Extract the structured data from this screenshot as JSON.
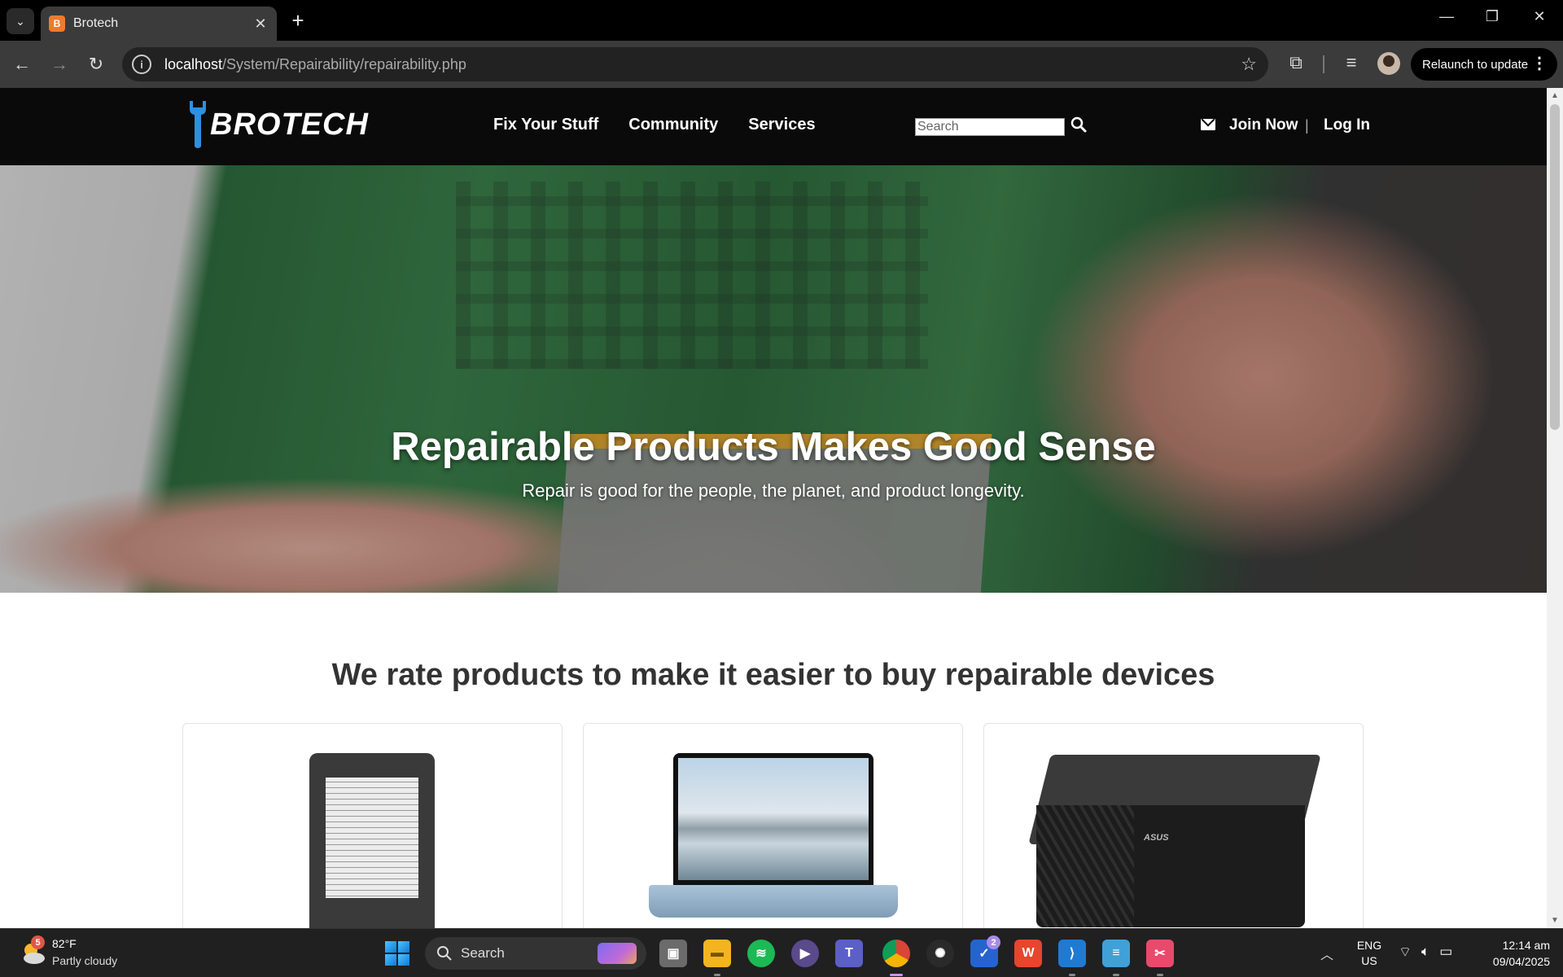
{
  "browser": {
    "tab_title": "Brotech",
    "tab_favicon_glyph": "B",
    "url_host": "localhost",
    "url_path": "/System/Repairability/repairability.php",
    "relaunch_label": "Relaunch to update"
  },
  "site": {
    "logo_text": "BROTECH",
    "nav": [
      "Fix Your Stuff",
      "Community",
      "Services"
    ],
    "search_placeholder": "Search",
    "join_label": "Join Now",
    "auth_separator": "|",
    "login_label": "Log In",
    "brand_color": "#2f8fe0"
  },
  "hero": {
    "title": "Repairable Products Makes Good Sense",
    "subtitle": "Repair is good for the people, the planet, and product longevity."
  },
  "section": {
    "title": "We rate products to make it easier to buy repairable devices"
  },
  "cards": [
    {
      "image": "e-reader"
    },
    {
      "image": "laptop"
    },
    {
      "image": "mini-pc",
      "brand": "ASUS"
    }
  ],
  "taskbar": {
    "weather_temp": "82°F",
    "weather_desc": "Partly cloudy",
    "weather_badge": "5",
    "search_label": "Search",
    "todo_badge": "2",
    "lang_line1": "ENG",
    "lang_line2": "US",
    "time": "12:14 am",
    "date": "09/04/2025"
  }
}
